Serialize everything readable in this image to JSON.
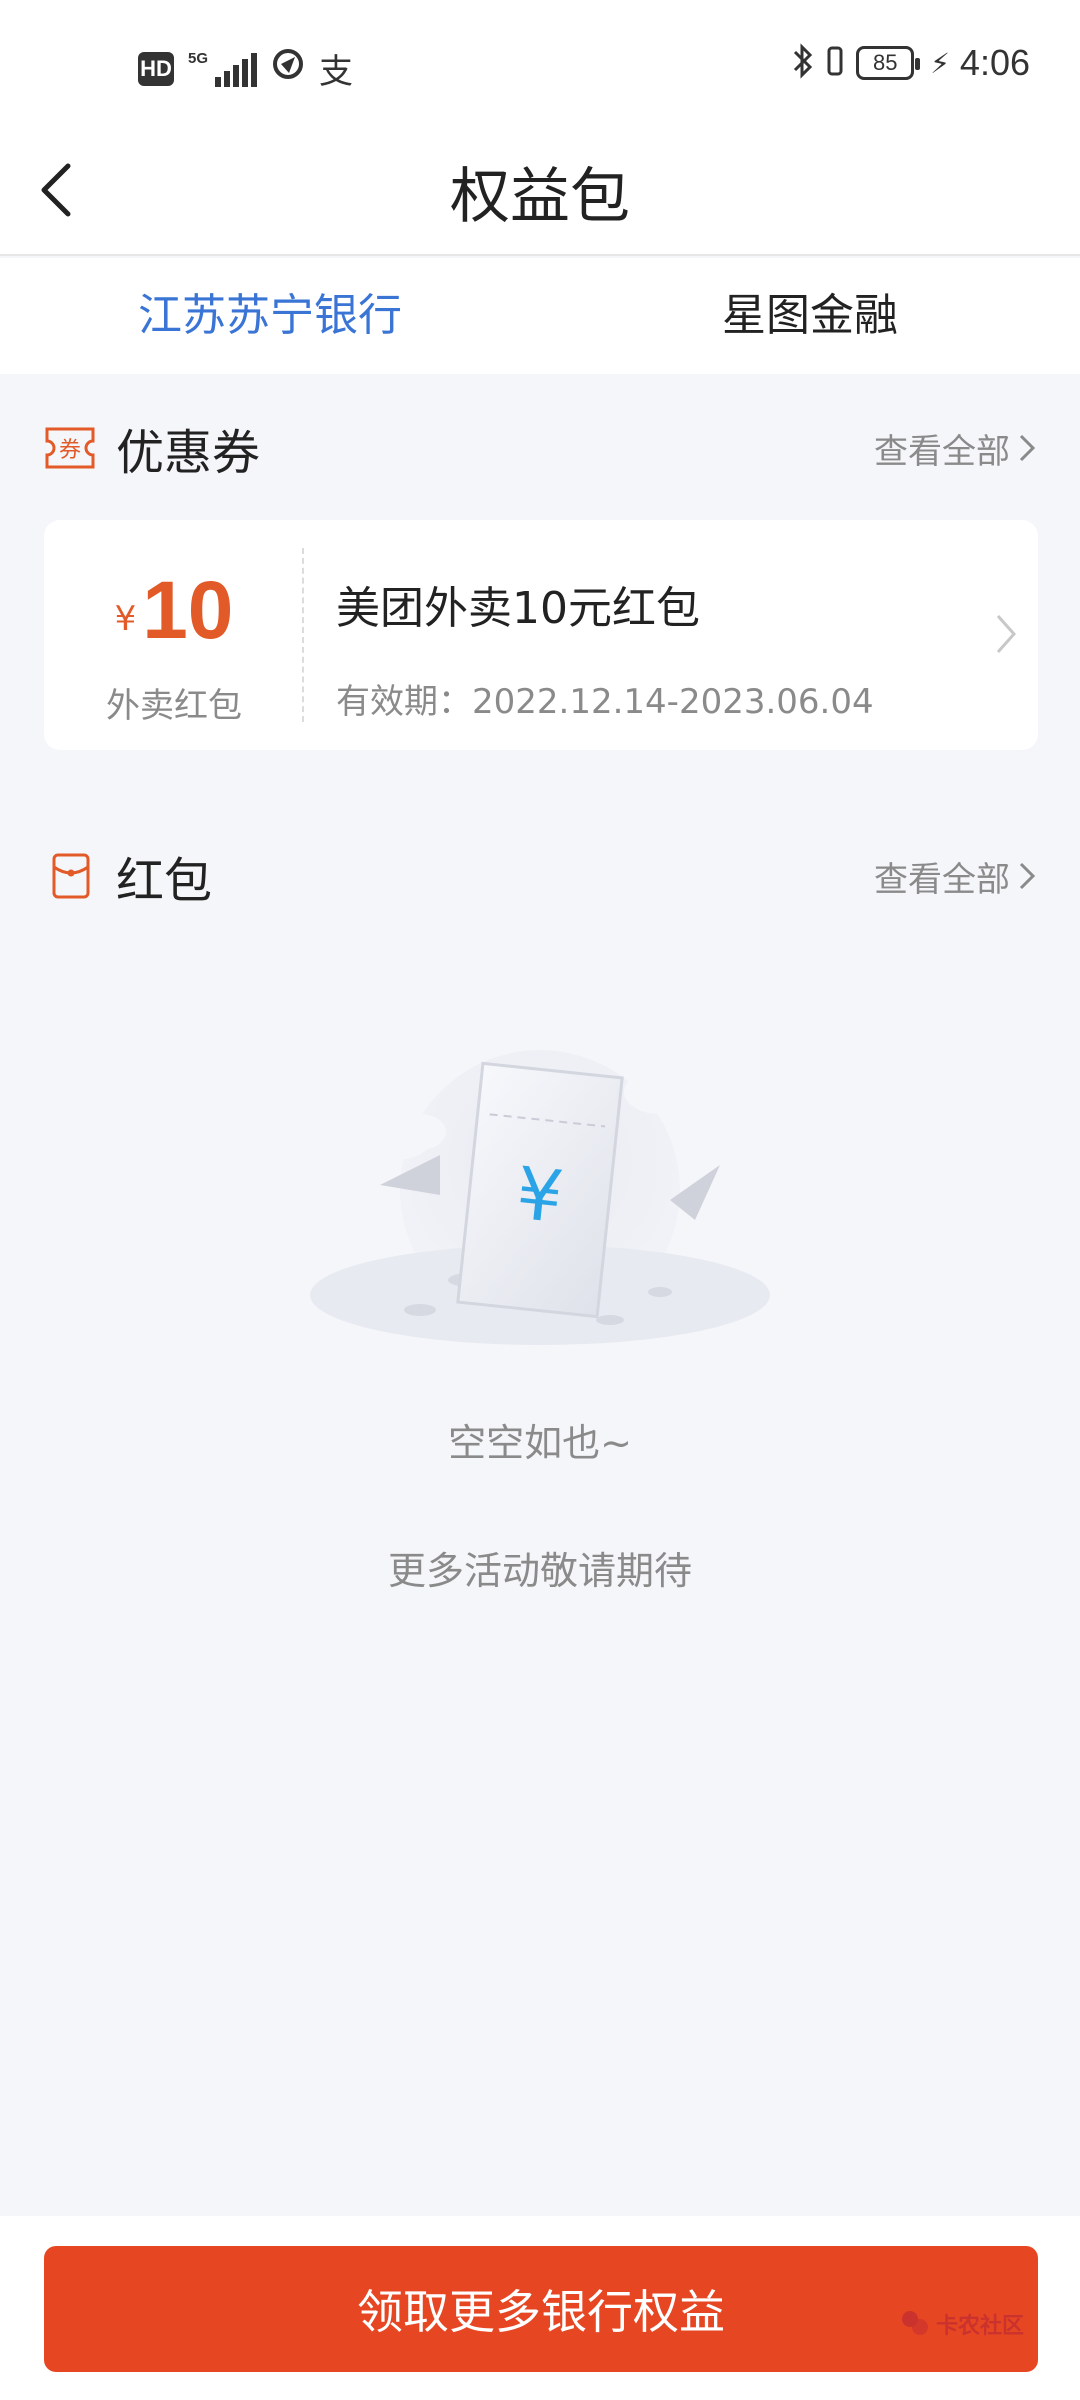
{
  "status_bar": {
    "hd": "HD",
    "network": "5G",
    "app_glyph": "支",
    "battery": "85",
    "time": "4:06"
  },
  "nav": {
    "title": "权益包"
  },
  "tabs": [
    {
      "label": "江苏苏宁银行",
      "active": true
    },
    {
      "label": "星图金融",
      "active": false
    }
  ],
  "coupon_section": {
    "icon_text": "券",
    "title": "优惠券",
    "view_all": "查看全部",
    "card": {
      "currency": "¥",
      "amount": "10",
      "type": "外卖红包",
      "name": "美团外卖10元红包",
      "validity": "有效期：2022.12.14-2023.06.04"
    }
  },
  "redpacket_section": {
    "title": "红包",
    "view_all": "查看全部",
    "empty_symbol": "¥",
    "empty_title": "空空如也~",
    "empty_subtitle": "更多活动敬请期待"
  },
  "cta": {
    "label": "领取更多银行权益"
  },
  "watermark": {
    "text": "卡农社区"
  },
  "colors": {
    "accent_blue": "#3a75d6",
    "accent_orange": "#e25a28",
    "cta_red": "#e74623",
    "background": "#f5f6fa"
  }
}
